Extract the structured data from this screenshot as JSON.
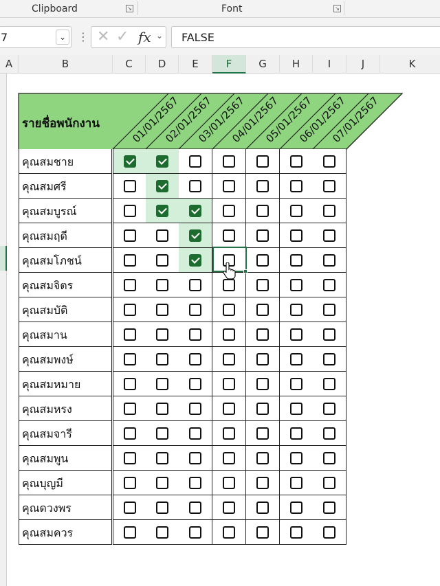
{
  "ribbon": {
    "groups": [
      {
        "label": "Clipboard"
      },
      {
        "label": "Font"
      }
    ]
  },
  "formula_bar": {
    "name_box_value": "7",
    "formula_value": "FALSE",
    "fx_label": "fx"
  },
  "columns": [
    "A",
    "B",
    "C",
    "D",
    "E",
    "F",
    "G",
    "H",
    "I",
    "J",
    "K"
  ],
  "active_column": "F",
  "sheet": {
    "title": "รายชื่อพนักงาน",
    "dates": [
      "01/01/2567",
      "02/01/2567",
      "03/01/2567",
      "04/01/2567",
      "05/01/2567",
      "06/01/2567",
      "07/01/2567"
    ],
    "header_color": "#8fd57f",
    "check_color": "#1e6b2f",
    "highlight_color": "#d4efd9",
    "rows": [
      {
        "name": "คุณสมชาย",
        "checks": [
          true,
          true,
          false,
          false,
          false,
          false,
          false
        ]
      },
      {
        "name": "คุณสมศรี",
        "checks": [
          false,
          true,
          false,
          false,
          false,
          false,
          false
        ]
      },
      {
        "name": "คุณสมบูรณ์",
        "checks": [
          false,
          true,
          true,
          false,
          false,
          false,
          false
        ]
      },
      {
        "name": "คุณสมฤดี",
        "checks": [
          false,
          false,
          true,
          false,
          false,
          false,
          false
        ]
      },
      {
        "name": "คุณสมโภชน์",
        "checks": [
          false,
          false,
          true,
          false,
          false,
          false,
          false
        ]
      },
      {
        "name": "คุณสมจิตร",
        "checks": [
          false,
          false,
          false,
          false,
          false,
          false,
          false
        ]
      },
      {
        "name": "คุณสมบัติ",
        "checks": [
          false,
          false,
          false,
          false,
          false,
          false,
          false
        ]
      },
      {
        "name": "คุณสมาน",
        "checks": [
          false,
          false,
          false,
          false,
          false,
          false,
          false
        ]
      },
      {
        "name": "คุณสมพงษ์",
        "checks": [
          false,
          false,
          false,
          false,
          false,
          false,
          false
        ]
      },
      {
        "name": "คุณสมหมาย",
        "checks": [
          false,
          false,
          false,
          false,
          false,
          false,
          false
        ]
      },
      {
        "name": "คุณสมหรง",
        "checks": [
          false,
          false,
          false,
          false,
          false,
          false,
          false
        ]
      },
      {
        "name": "คุณสมจารี",
        "checks": [
          false,
          false,
          false,
          false,
          false,
          false,
          false
        ]
      },
      {
        "name": "คุณสมพูน",
        "checks": [
          false,
          false,
          false,
          false,
          false,
          false,
          false
        ]
      },
      {
        "name": "คุณบุญมี",
        "checks": [
          false,
          false,
          false,
          false,
          false,
          false,
          false
        ]
      },
      {
        "name": "คุณดวงพร",
        "checks": [
          false,
          false,
          false,
          false,
          false,
          false,
          false
        ]
      },
      {
        "name": "คุณสมควร",
        "checks": [
          false,
          false,
          false,
          false,
          false,
          false,
          false
        ]
      }
    ]
  }
}
